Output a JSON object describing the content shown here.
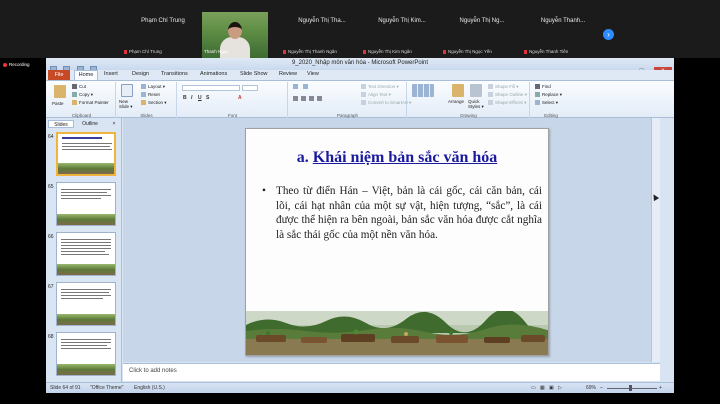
{
  "zoom": {
    "participants": [
      {
        "name": "Phạm Chí Trung",
        "label": "Phạm Chí Trung",
        "video": false
      },
      {
        "name": "",
        "label": "Thanh Ngọc",
        "video": true
      },
      {
        "name": "Nguyễn Thị Tha...",
        "label": "Nguyễn Thị Thanh Ngân",
        "video": false
      },
      {
        "name": "Nguyễn Thị Kim...",
        "label": "Nguyễn Thị Kim Ngân",
        "video": false
      },
      {
        "name": "Nguyễn Thị Ng...",
        "label": "Nguyễn Thị Ngọc Yến",
        "video": false
      },
      {
        "name": "Nguyễn Thanh...",
        "label": "Nguyễn Thanh Tiền",
        "video": false
      }
    ],
    "next_icon": "chevron-right-icon",
    "recording_label": "Recording"
  },
  "window": {
    "title": "9_2020_Nhập môn văn hóa  -  Microsoft PowerPoint",
    "controls": {
      "minimize": "–",
      "maximize": "□",
      "close": "×"
    }
  },
  "ribbon": {
    "tabs": [
      "File",
      "Home",
      "Insert",
      "Design",
      "Transitions",
      "Animations",
      "Slide Show",
      "Review",
      "View"
    ],
    "clipboard": {
      "paste": "Paste",
      "cut": "Cut",
      "copy": "Copy ▾",
      "format_painter": "Format Painter",
      "label": "Clipboard"
    },
    "slides": {
      "new_slide": "New Slide ▾",
      "layout": "Layout ▾",
      "reset": "Reset",
      "section": "Section ▾",
      "label": "Slides"
    },
    "font": {
      "label": "Font"
    },
    "paragraph": {
      "text_direction": "Text Direction ▾",
      "align_text": "Align Text ▾",
      "convert": "Convert to SmartArt ▾",
      "label": "Paragraph"
    },
    "drawing": {
      "arrange": "Arrange",
      "quick_styles": "Quick Styles ▾",
      "shape_fill": "Shape Fill ▾",
      "shape_outline": "Shape Outline ▾",
      "shape_effects": "Shape Effects ▾",
      "label": "Drawing"
    },
    "editing": {
      "find": "Find",
      "replace": "Replace ▾",
      "select": "Select ▾",
      "label": "Editing"
    }
  },
  "panel": {
    "tabs": {
      "slides": "Slides",
      "outline": "Outline",
      "close": "×"
    },
    "thumbnails": [
      {
        "number": "64",
        "title": "a. Khái niệm bản sắc văn hóa",
        "selected": true
      },
      {
        "number": "65",
        "title": "",
        "selected": false
      },
      {
        "number": "66",
        "title": "",
        "selected": false
      },
      {
        "number": "67",
        "title": "",
        "selected": false
      },
      {
        "number": "68",
        "title": "",
        "selected": false
      }
    ]
  },
  "slide": {
    "title_prefix": "a. ",
    "title_link": "Khái niệm bản sắc văn hóa",
    "bullet": "•",
    "body": "Theo từ điển Hán – Việt, bản là cái gốc, cái căn bản, cái lõi, cái hạt nhân của một sự vật, hiện tượng, “sắc”, là cái được thể hiện ra bên ngoài, bản sắc văn hóa được cắt nghĩa là sắc thái gốc của một nền văn hóa."
  },
  "notes": {
    "placeholder": "Click to add notes"
  },
  "status": {
    "slide_info": "Slide 64 of 91",
    "theme": "\"Office Theme\"",
    "language": "English (U.S.)",
    "zoom": "69%",
    "zoom_out": "–",
    "zoom_in": "+"
  }
}
